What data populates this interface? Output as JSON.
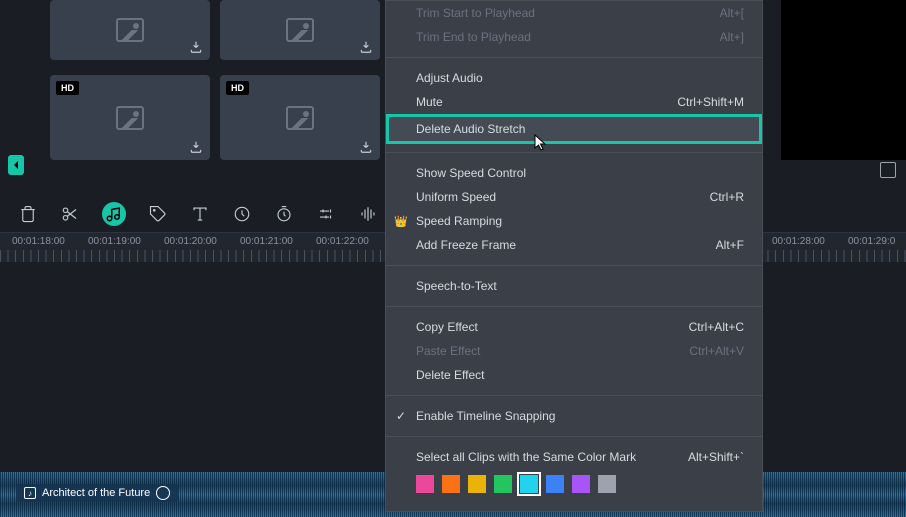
{
  "media": {
    "hd_label": "HD"
  },
  "audio_clip": {
    "title": "Architect of the Future"
  },
  "timeline": {
    "codes": [
      "00:01:18:00",
      "00:01:19:00",
      "00:01:20:00",
      "00:01:21:00",
      "00:01:22:00",
      "",
      "",
      "",
      "",
      "",
      "00:01:28:00",
      "00:01:29:0"
    ]
  },
  "context_menu": {
    "trim_start": "Trim Start to Playhead",
    "trim_start_sc": "Alt+[",
    "trim_end": "Trim End to Playhead",
    "trim_end_sc": "Alt+]",
    "adjust_audio": "Adjust Audio",
    "mute": "Mute",
    "mute_sc": "Ctrl+Shift+M",
    "delete_audio_stretch": "Delete Audio Stretch",
    "show_speed": "Show Speed Control",
    "uniform_speed": "Uniform Speed",
    "uniform_speed_sc": "Ctrl+R",
    "speed_ramping": "Speed Ramping",
    "add_freeze": "Add Freeze Frame",
    "add_freeze_sc": "Alt+F",
    "stt": "Speech-to-Text",
    "copy_effect": "Copy Effect",
    "copy_effect_sc": "Ctrl+Alt+C",
    "paste_effect": "Paste Effect",
    "paste_effect_sc": "Ctrl+Alt+V",
    "delete_effect": "Delete Effect",
    "snapping": "Enable Timeline Snapping",
    "select_color": "Select all Clips with the Same Color Mark",
    "select_color_sc": "Alt+Shift+`"
  },
  "colors": [
    "#ec4899",
    "#f97316",
    "#eab308",
    "#22c55e",
    "#22d3ee",
    "#3b82f6",
    "#a855f7",
    "#9ca3af"
  ]
}
